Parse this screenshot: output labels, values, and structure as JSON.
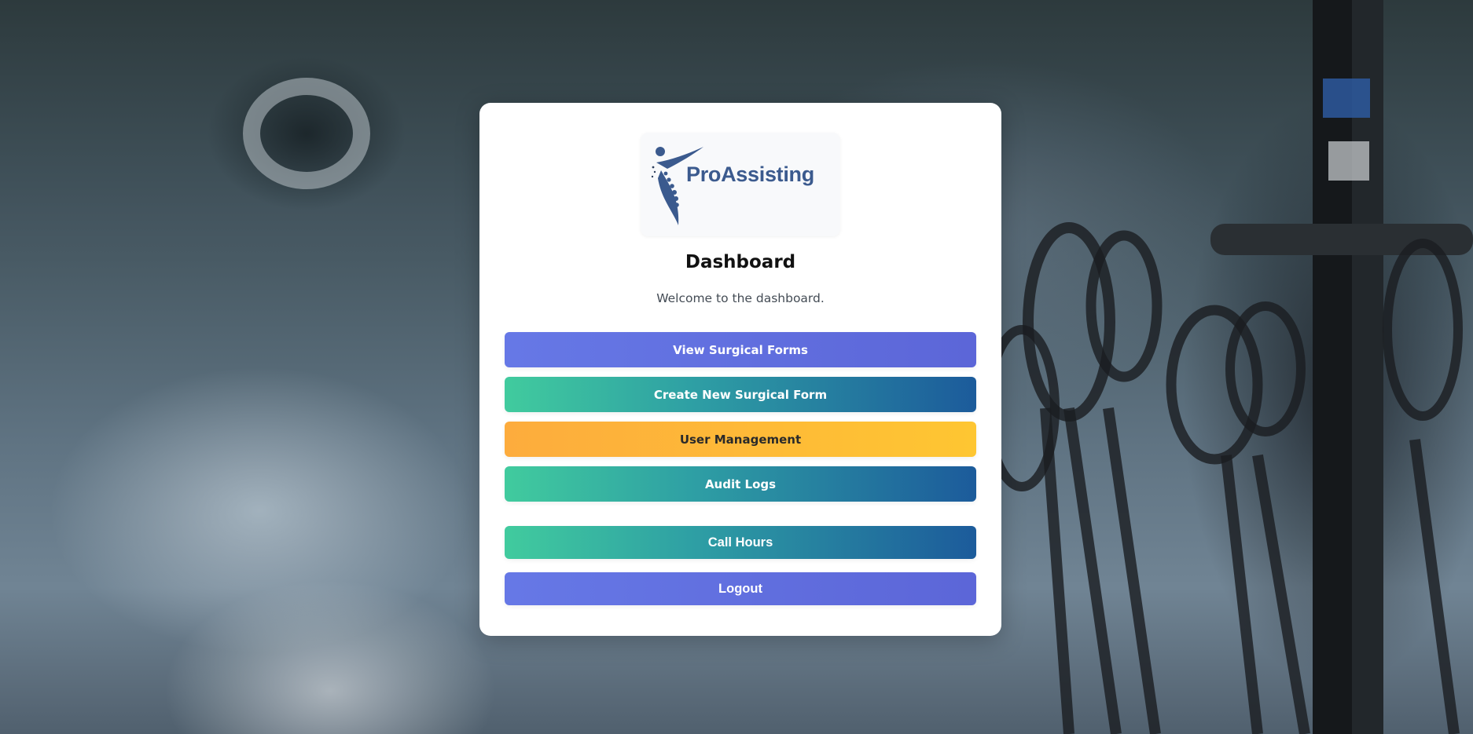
{
  "app": {
    "logo_text": "ProAssisting"
  },
  "dashboard": {
    "title": "Dashboard",
    "welcome": "Welcome to the dashboard."
  },
  "buttons": {
    "view_surgical_forms": "View Surgical Forms",
    "create_new_surgical_form": "Create New Surgical Form",
    "user_management": "User Management",
    "audit_logs": "Audit Logs",
    "call_hours": "Call Hours",
    "logout": "Logout"
  },
  "colors": {
    "brand_blue": "#3b5a8e",
    "purple_button": "#6070e0",
    "teal_start": "#41cb9e",
    "navy_end": "#1c5b9b",
    "amber_start": "#fdac3d",
    "amber_end": "#fec632"
  }
}
